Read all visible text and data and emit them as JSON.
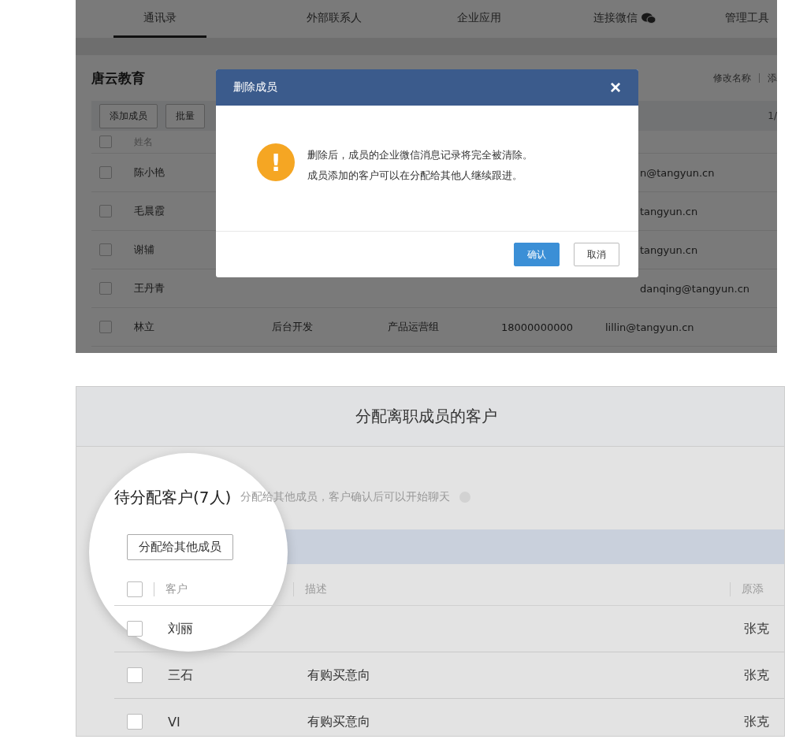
{
  "top_screen": {
    "tabs": [
      {
        "label": "通讯录",
        "selected": true
      },
      {
        "label": "外部联系人",
        "selected": false
      },
      {
        "label": "企业应用",
        "selected": false
      },
      {
        "label": "连接微信",
        "selected": false,
        "kind": "wechat"
      },
      {
        "label": "管理工具",
        "selected": false
      }
    ],
    "org_name": "唐云教育",
    "header_links": [
      "修改名称",
      "添"
    ],
    "toolbar_buttons": [
      "添加成员",
      "批量"
    ],
    "pagination": "1/",
    "select_all_checked": false,
    "column": "姓名",
    "rows": [
      {
        "name": "陈小艳",
        "checked": false,
        "email": "n@tangyun.cn"
      },
      {
        "name": "毛晨霞",
        "checked": false,
        "email": "tangyun.cn"
      },
      {
        "name": "谢辅",
        "checked": false,
        "email": "tangyun.cn"
      },
      {
        "name": "王丹青",
        "checked": false,
        "email": "danqing@tangyun.cn"
      },
      {
        "name": "林立",
        "checked": false,
        "position": "后台开发",
        "department": "产品运营组",
        "phone": "18000000000",
        "email": "lillin@tangyun.cn"
      }
    ],
    "dialog": {
      "title": "删除成员",
      "close": "×",
      "icon": "!",
      "message": [
        "删除后，成员的企业微信消息记录将完全被清除。",
        "成员添加的客户可以在分配给其他人继续跟进。"
      ],
      "buttons": [
        {
          "label": "确认",
          "kind": "primary"
        },
        {
          "label": "取消",
          "kind": "secondary"
        }
      ]
    }
  },
  "bottom_screen": {
    "title": "分配离职成员的客户",
    "section_title": "待分配客户(7人)",
    "section_hint": "分配给其他成员，客户确认后可以开始聊天",
    "action_button": "分配给其他成员",
    "select_all_checked": false,
    "columns": [
      "客户",
      "描述",
      "原添"
    ],
    "rows": [
      {
        "customer": "刘丽",
        "checked": false,
        "owner": "张克"
      },
      {
        "customer": "三石",
        "checked": false,
        "description": "有购买意向",
        "owner": "张克"
      },
      {
        "customer": "VI",
        "checked": false,
        "description": "有购买意向",
        "owner": "张克"
      }
    ]
  }
}
